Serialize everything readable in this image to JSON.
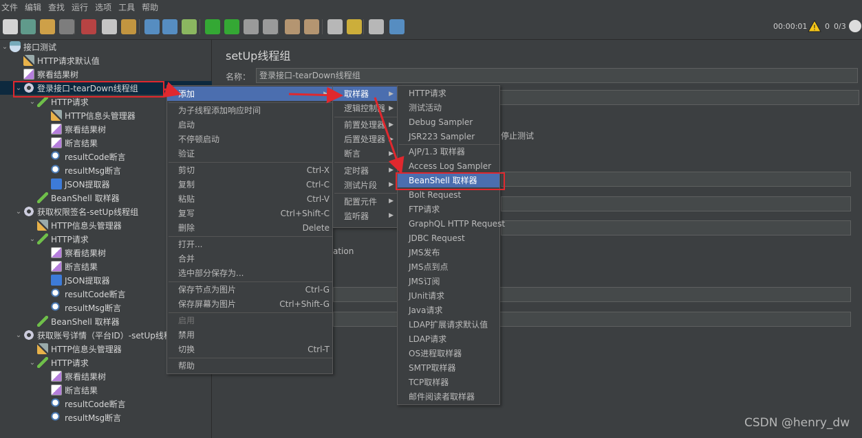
{
  "menubar": [
    "文件",
    "编辑",
    "查找",
    "运行",
    "选项",
    "工具",
    "帮助"
  ],
  "toolbar": {
    "icons": [
      "new",
      "templates",
      "open",
      "save",
      "cut",
      "copy",
      "paste",
      "expand",
      "collapse",
      "toggle",
      "start",
      "start-no-pause",
      "stop",
      "shutdown",
      "clear",
      "clear-all",
      "search",
      "reset-search",
      "function-helper",
      "help"
    ],
    "timer": "00:00:01",
    "warning_icon": "warning-icon",
    "error_count": "0",
    "threads": "0/3"
  },
  "tree": [
    {
      "level": 0,
      "chev": "⌄",
      "icon": "flask",
      "label": "接口测试"
    },
    {
      "level": 1,
      "chev": "",
      "icon": "tools",
      "label": "HTTP请求默认值"
    },
    {
      "level": 1,
      "chev": "",
      "icon": "chart",
      "label": "察看结果树"
    },
    {
      "level": 1,
      "chev": "⌄",
      "icon": "gear",
      "label": "登录接口-tearDown线程组",
      "selected": true
    },
    {
      "level": 2,
      "chev": "⌄",
      "icon": "pen",
      "label": "HTTP请求"
    },
    {
      "level": 3,
      "chev": "",
      "icon": "tools",
      "label": "HTTP信息头管理器"
    },
    {
      "level": 3,
      "chev": "",
      "icon": "chart",
      "label": "察看结果树"
    },
    {
      "level": 3,
      "chev": "",
      "icon": "chart",
      "label": "断言结果"
    },
    {
      "level": 3,
      "chev": "",
      "icon": "mag",
      "label": "resultCode断言"
    },
    {
      "level": 3,
      "chev": "",
      "icon": "mag",
      "label": "resultMsg断言"
    },
    {
      "level": 3,
      "chev": "",
      "icon": "json",
      "label": "JSON提取器"
    },
    {
      "level": 2,
      "chev": "",
      "icon": "pen",
      "label": "BeanShell 取样器"
    },
    {
      "level": 1,
      "chev": "⌄",
      "icon": "gear",
      "label": "获取权限签名-setUp线程组"
    },
    {
      "level": 2,
      "chev": "",
      "icon": "tools",
      "label": "HTTP信息头管理器"
    },
    {
      "level": 2,
      "chev": "⌄",
      "icon": "pen",
      "label": "HTTP请求"
    },
    {
      "level": 3,
      "chev": "",
      "icon": "chart",
      "label": "察看结果树"
    },
    {
      "level": 3,
      "chev": "",
      "icon": "chart",
      "label": "断言结果"
    },
    {
      "level": 3,
      "chev": "",
      "icon": "json",
      "label": "JSON提取器"
    },
    {
      "level": 3,
      "chev": "",
      "icon": "mag",
      "label": "resultCode断言"
    },
    {
      "level": 3,
      "chev": "",
      "icon": "mag",
      "label": "resultMsg断言"
    },
    {
      "level": 2,
      "chev": "",
      "icon": "pen",
      "label": "BeanShell 取样器"
    },
    {
      "level": 1,
      "chev": "⌄",
      "icon": "gear",
      "label": "获取账号详情（平台ID）-setUp线程"
    },
    {
      "level": 2,
      "chev": "",
      "icon": "tools",
      "label": "HTTP信息头管理器"
    },
    {
      "level": 2,
      "chev": "⌄",
      "icon": "pen",
      "label": "HTTP请求"
    },
    {
      "level": 3,
      "chev": "",
      "icon": "chart",
      "label": "察看结果树"
    },
    {
      "level": 3,
      "chev": "",
      "icon": "chart",
      "label": "断言结果"
    },
    {
      "level": 3,
      "chev": "",
      "icon": "mag",
      "label": "resultCode断言"
    },
    {
      "level": 3,
      "chev": "",
      "icon": "mag",
      "label": "resultMsg断言"
    }
  ],
  "panel": {
    "title": "setUp线程组",
    "name_label": "名称：",
    "name_value": "登录接口-tearDown线程组",
    "stop_text": "停止测试",
    "ation_text": "ation"
  },
  "context_menu": [
    {
      "label": "添加",
      "shortcut": "",
      "arrow": true,
      "highlight": true
    },
    {
      "sep": true
    },
    {
      "label": "为子线程添加响应时间",
      "shortcut": ""
    },
    {
      "label": "启动",
      "shortcut": ""
    },
    {
      "label": "不停顿启动",
      "shortcut": ""
    },
    {
      "label": "验证",
      "shortcut": ""
    },
    {
      "sep": true
    },
    {
      "label": "剪切",
      "shortcut": "Ctrl-X"
    },
    {
      "label": "复制",
      "shortcut": "Ctrl-C"
    },
    {
      "label": "粘贴",
      "shortcut": "Ctrl-V"
    },
    {
      "label": "复写",
      "shortcut": "Ctrl+Shift-C"
    },
    {
      "label": "删除",
      "shortcut": "Delete"
    },
    {
      "sep": true
    },
    {
      "label": "打开...",
      "shortcut": ""
    },
    {
      "label": "合并",
      "shortcut": ""
    },
    {
      "label": "选中部分保存为...",
      "shortcut": ""
    },
    {
      "sep": true
    },
    {
      "label": "保存节点为图片",
      "shortcut": "Ctrl-G"
    },
    {
      "label": "保存屏幕为图片",
      "shortcut": "Ctrl+Shift-G"
    },
    {
      "sep": true
    },
    {
      "label": "启用",
      "shortcut": "",
      "disabled": true
    },
    {
      "label": "禁用",
      "shortcut": ""
    },
    {
      "label": "切换",
      "shortcut": "Ctrl-T"
    },
    {
      "sep": true
    },
    {
      "label": "帮助",
      "shortcut": ""
    }
  ],
  "add_menu": [
    {
      "label": "取样器",
      "arrow": true,
      "highlight": true
    },
    {
      "label": "逻辑控制器",
      "arrow": true
    },
    {
      "sep": true
    },
    {
      "label": "前置处理器",
      "arrow": true
    },
    {
      "label": "后置处理器",
      "arrow": true
    },
    {
      "label": "断言",
      "arrow": true
    },
    {
      "sep": true
    },
    {
      "label": "定时器",
      "arrow": true
    },
    {
      "label": "测试片段",
      "arrow": true
    },
    {
      "sep": true
    },
    {
      "label": "配置元件",
      "arrow": true
    },
    {
      "label": "监听器",
      "arrow": true
    }
  ],
  "sampler_menu": [
    {
      "label": "HTTP请求"
    },
    {
      "label": "测试活动"
    },
    {
      "label": "Debug Sampler"
    },
    {
      "label": "JSR223 Sampler"
    },
    {
      "sep": true
    },
    {
      "label": "AJP/1.3 取样器"
    },
    {
      "label": "Access Log Sampler"
    },
    {
      "label": "BeanShell 取样器",
      "highlight": true
    },
    {
      "label": "Bolt Request"
    },
    {
      "label": "FTP请求"
    },
    {
      "label": "GraphQL HTTP Request"
    },
    {
      "label": "JDBC Request"
    },
    {
      "label": "JMS发布"
    },
    {
      "label": "JMS点到点"
    },
    {
      "label": "JMS订阅"
    },
    {
      "label": "JUnit请求"
    },
    {
      "label": "Java请求"
    },
    {
      "label": "LDAP扩展请求默认值"
    },
    {
      "label": "LDAP请求"
    },
    {
      "label": "OS进程取样器"
    },
    {
      "label": "SMTP取样器"
    },
    {
      "label": "TCP取样器"
    },
    {
      "label": "邮件阅读者取样器"
    }
  ],
  "watermark": "CSDN @henry_dw",
  "colors": {
    "highlight": "#4b6eaf",
    "annotation": "#e0282e",
    "selection": "#0d293e"
  }
}
